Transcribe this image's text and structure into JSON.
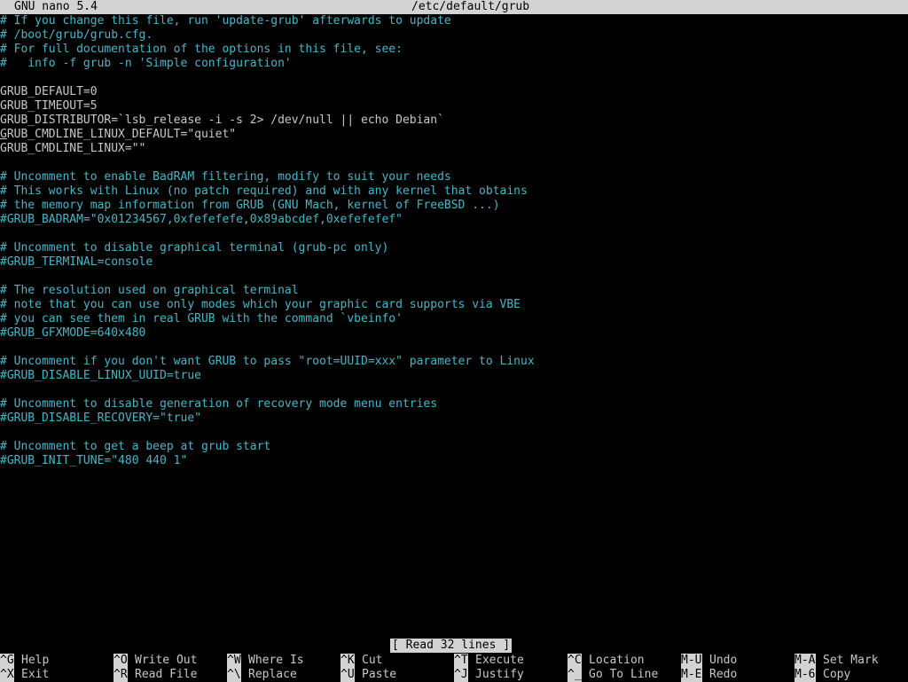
{
  "titlebar": {
    "app": "GNU nano 5.4",
    "file": "/etc/default/grub"
  },
  "lines": [
    {
      "text": "# If you change this file, run 'update-grub' afterwards to update",
      "type": "comment"
    },
    {
      "text": "# /boot/grub/grub.cfg.",
      "type": "comment"
    },
    {
      "text": "# For full documentation of the options in this file, see:",
      "type": "comment"
    },
    {
      "text": "#   info -f grub -n 'Simple configuration'",
      "type": "comment"
    },
    {
      "text": "",
      "type": "plain"
    },
    {
      "text": "GRUB_DEFAULT=0",
      "type": "plain"
    },
    {
      "text": "GRUB_TIMEOUT=5",
      "type": "plain"
    },
    {
      "text": "GRUB_DISTRIBUTOR=`lsb_release -i -s 2> /dev/null || echo Debian`",
      "type": "plain"
    },
    {
      "text": "GRUB_CMDLINE_LINUX_DEFAULT=\"quiet\"",
      "type": "plain",
      "cursor": true
    },
    {
      "text": "GRUB_CMDLINE_LINUX=\"\"",
      "type": "plain"
    },
    {
      "text": "",
      "type": "plain"
    },
    {
      "text": "# Uncomment to enable BadRAM filtering, modify to suit your needs",
      "type": "comment"
    },
    {
      "text": "# This works with Linux (no patch required) and with any kernel that obtains",
      "type": "comment"
    },
    {
      "text": "# the memory map information from GRUB (GNU Mach, kernel of FreeBSD ...)",
      "type": "comment"
    },
    {
      "text": "#GRUB_BADRAM=\"0x01234567,0xfefefefe,0x89abcdef,0xefefefef\"",
      "type": "comment"
    },
    {
      "text": "",
      "type": "plain"
    },
    {
      "text": "# Uncomment to disable graphical terminal (grub-pc only)",
      "type": "comment"
    },
    {
      "text": "#GRUB_TERMINAL=console",
      "type": "comment"
    },
    {
      "text": "",
      "type": "plain"
    },
    {
      "text": "# The resolution used on graphical terminal",
      "type": "comment"
    },
    {
      "text": "# note that you can use only modes which your graphic card supports via VBE",
      "type": "comment"
    },
    {
      "text": "# you can see them in real GRUB with the command `vbeinfo'",
      "type": "comment"
    },
    {
      "text": "#GRUB_GFXMODE=640x480",
      "type": "comment"
    },
    {
      "text": "",
      "type": "plain"
    },
    {
      "text": "# Uncomment if you don't want GRUB to pass \"root=UUID=xxx\" parameter to Linux",
      "type": "comment"
    },
    {
      "text": "#GRUB_DISABLE_LINUX_UUID=true",
      "type": "comment"
    },
    {
      "text": "",
      "type": "plain"
    },
    {
      "text": "# Uncomment to disable generation of recovery mode menu entries",
      "type": "comment"
    },
    {
      "text": "#GRUB_DISABLE_RECOVERY=\"true\"",
      "type": "comment"
    },
    {
      "text": "",
      "type": "plain"
    },
    {
      "text": "# Uncomment to get a beep at grub start",
      "type": "comment"
    },
    {
      "text": "#GRUB_INIT_TUNE=\"480 440 1\"",
      "type": "comment"
    }
  ],
  "status": "[ Read 32 lines ]",
  "shortcuts": [
    {
      "key": "^G",
      "label": "Help"
    },
    {
      "key": "^X",
      "label": "Exit"
    },
    {
      "key": "^O",
      "label": "Write Out"
    },
    {
      "key": "^R",
      "label": "Read File"
    },
    {
      "key": "^W",
      "label": "Where Is"
    },
    {
      "key": "^\\",
      "label": "Replace"
    },
    {
      "key": "^K",
      "label": "Cut"
    },
    {
      "key": "^U",
      "label": "Paste"
    },
    {
      "key": "^T",
      "label": "Execute"
    },
    {
      "key": "^J",
      "label": "Justify"
    },
    {
      "key": "^C",
      "label": "Location"
    },
    {
      "key": "^_",
      "label": "Go To Line"
    },
    {
      "key": "M-U",
      "label": "Undo"
    },
    {
      "key": "M-E",
      "label": "Redo"
    },
    {
      "key": "M-A",
      "label": "Set Mark"
    },
    {
      "key": "M-6",
      "label": "Copy"
    }
  ],
  "colors": {
    "comment": "#43b7c9",
    "plain": "#c8c8c8",
    "bar_bg": "#d3d3d3",
    "background": "#000000"
  }
}
